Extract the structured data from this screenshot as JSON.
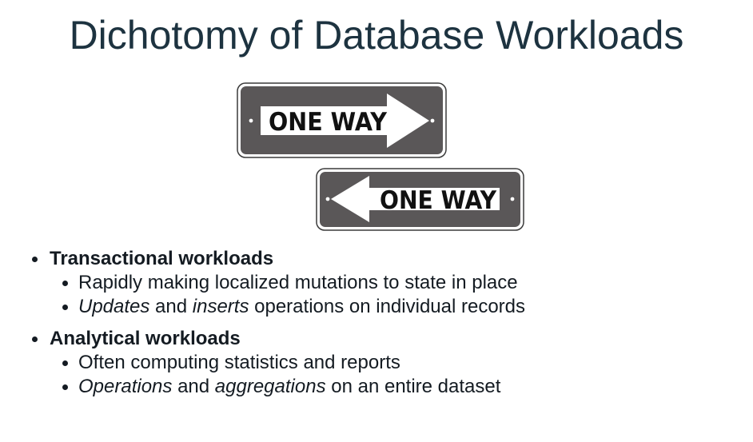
{
  "slide": {
    "title": "Dichotomy of Database Workloads"
  },
  "signs": [
    {
      "text": "ONE WAY",
      "direction": "right"
    },
    {
      "text": "ONE WAY",
      "direction": "left"
    }
  ],
  "bullets": {
    "transactional": {
      "heading": "Transactional workloads",
      "item1": "Rapidly making localized mutations to state in place",
      "item2_em1": "Updates",
      "item2_mid": " and ",
      "item2_em2": "inserts",
      "item2_tail": " operations on individual records"
    },
    "analytical": {
      "heading": "Analytical workloads",
      "item1": "Often computing statistics and reports",
      "item2_em1": "Operations",
      "item2_mid": " and ",
      "item2_em2": "aggregations",
      "item2_tail": " on an entire dataset"
    }
  },
  "colors": {
    "title": "#1d3340",
    "sign_plate": "#5a5758",
    "sign_border": "#3a3a3a",
    "sign_arrow": "#ffffff"
  }
}
